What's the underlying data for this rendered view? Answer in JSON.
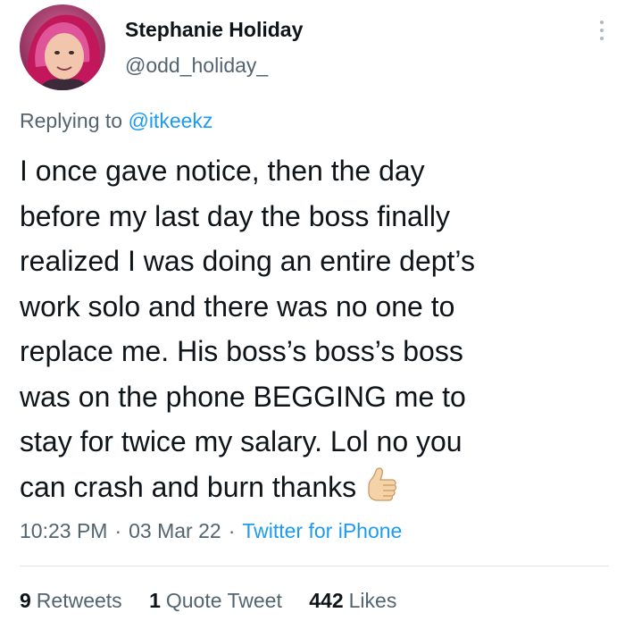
{
  "user": {
    "display_name": "Stephanie Holiday",
    "handle": "@odd_holiday_"
  },
  "icons": {
    "avatar": "profile-photo",
    "more": "more-options-vertical-dots-icon",
    "emoji": "thumbs-up-emoji"
  },
  "reply": {
    "prefix": "Replying to",
    "mention": "@itkeekz"
  },
  "tweet": {
    "lines": [
      "I once gave notice, then the day",
      "before my last day the boss finally",
      "realized I was doing an entire dept’s",
      "work solo and there was no one to",
      "replace me. His boss’s boss’s boss",
      "was on the phone BEGGING me to",
      "stay for twice my salary. Lol no you",
      "can crash and burn thanks"
    ]
  },
  "meta": {
    "time": "10:23 PM",
    "date": "03 Mar 22",
    "separator": "·",
    "source": "Twitter for iPhone"
  },
  "stats": {
    "retweets_count": "9",
    "retweets_label": "Retweets",
    "quotes_count": "1",
    "quotes_label": "Quote Tweet",
    "likes_count": "442",
    "likes_label": "Likes"
  },
  "colors": {
    "text": "#0f1419",
    "secondary": "#536471",
    "link": "#1d9bf0",
    "divider": "#dfe5ea"
  }
}
